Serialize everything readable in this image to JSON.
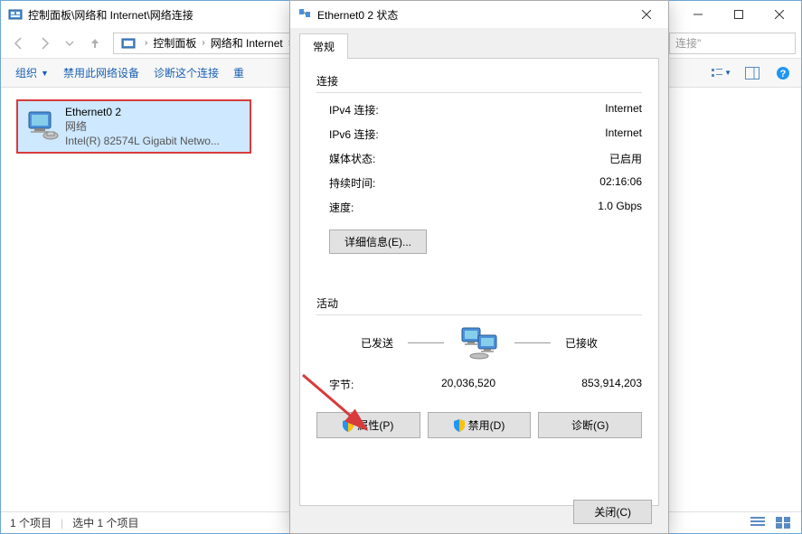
{
  "window": {
    "title": "控制面板\\网络和 Internet\\网络连接",
    "breadcrumbs": [
      "控制面板",
      "网络和 Internet"
    ],
    "search_placeholder": "连接\""
  },
  "toolbar": {
    "organize": "组织",
    "disable_device": "禁用此网络设备",
    "diagnose": "诊断这个连接",
    "rename": "重"
  },
  "adapter": {
    "name": "Ethernet0 2",
    "status": "网络",
    "device": "Intel(R) 82574L Gigabit Netwo..."
  },
  "statusbar": {
    "items": "1 个项目",
    "selected": "选中 1 个项目"
  },
  "dialog": {
    "title": "Ethernet0 2 状态",
    "tab_general": "常规",
    "section_connection": "连接",
    "rows": {
      "ipv4_label": "IPv4 连接:",
      "ipv4_value": "Internet",
      "ipv6_label": "IPv6 连接:",
      "ipv6_value": "Internet",
      "media_label": "媒体状态:",
      "media_value": "已启用",
      "duration_label": "持续时间:",
      "duration_value": "02:16:06",
      "speed_label": "速度:",
      "speed_value": "1.0 Gbps"
    },
    "details_btn": "详细信息(E)...",
    "section_activity": "活动",
    "sent_label": "已发送",
    "recv_label": "已接收",
    "bytes_label": "字节:",
    "bytes_sent": "20,036,520",
    "bytes_recv": "853,914,203",
    "btn_properties": "属性(P)",
    "btn_disable": "禁用(D)",
    "btn_diagnose": "诊断(G)",
    "btn_close": "关闭(C)"
  }
}
